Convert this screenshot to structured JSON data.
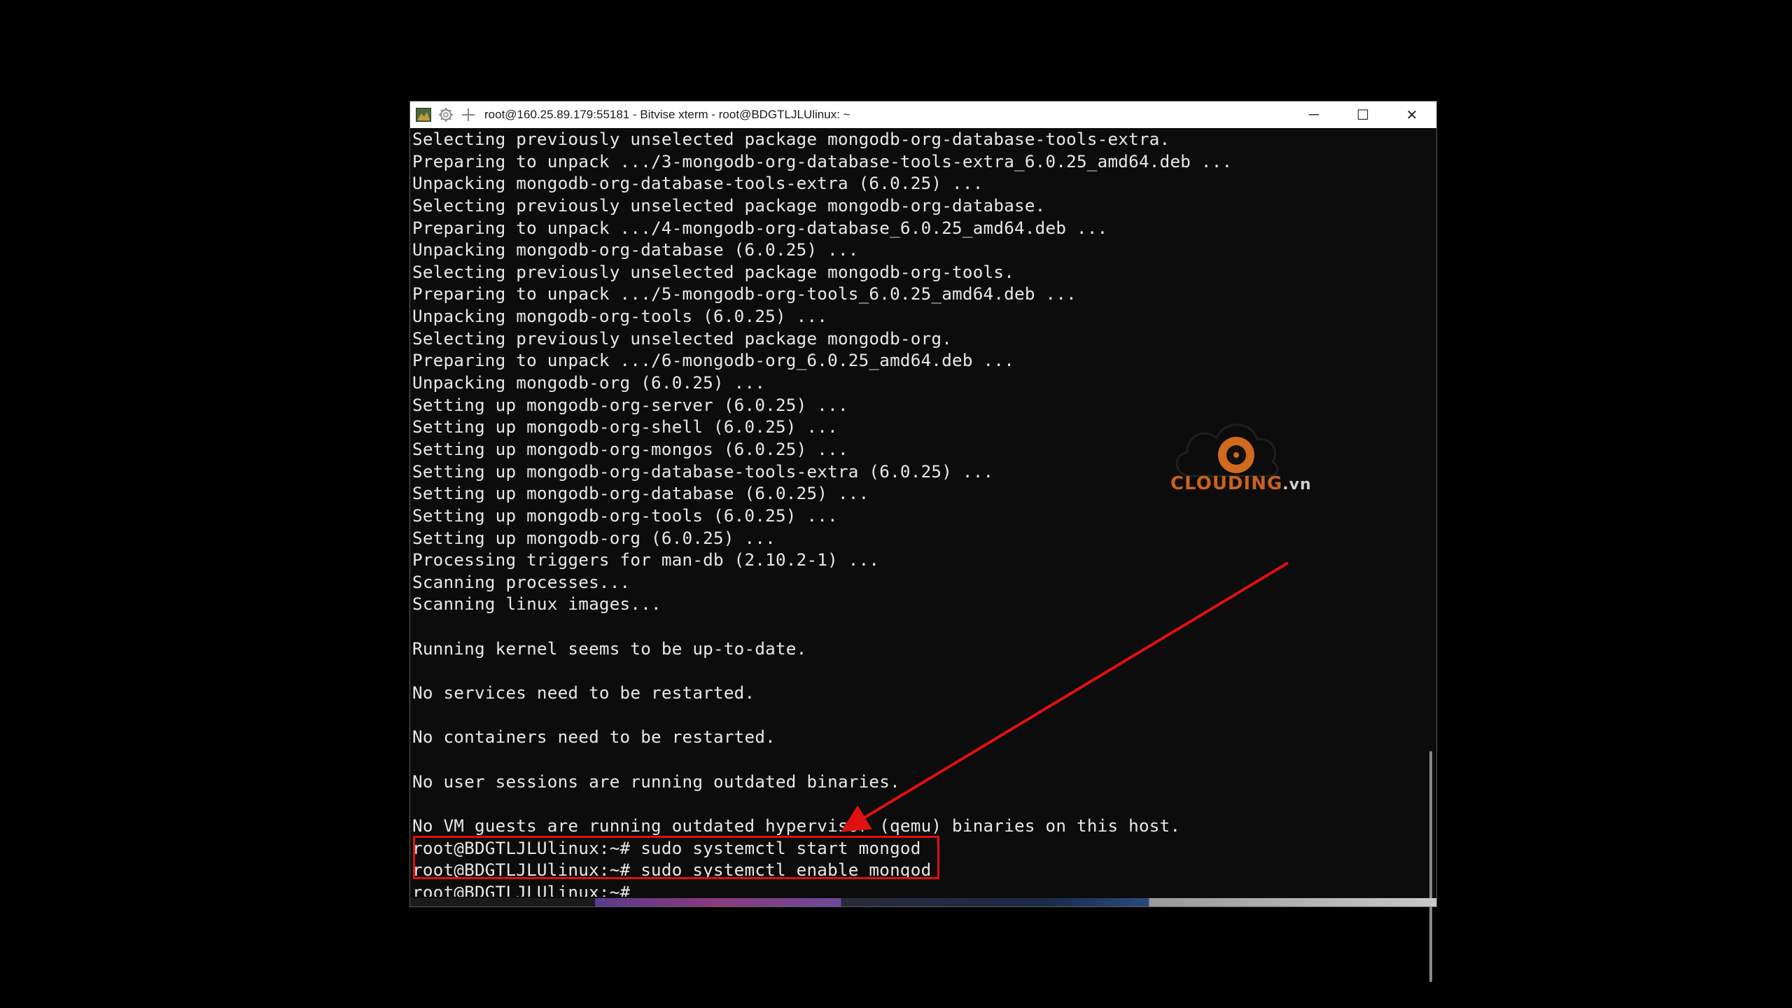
{
  "window": {
    "title": "root@160.25.89.179:55181 - Bitvise xterm - root@BDGTLJLUlinux: ~",
    "controls": {
      "minimize": "─",
      "maximize": "☐",
      "close": "✕"
    }
  },
  "terminal": {
    "lines": [
      "Selecting previously unselected package mongodb-org-database-tools-extra.",
      "Preparing to unpack .../3-mongodb-org-database-tools-extra_6.0.25_amd64.deb ...",
      "Unpacking mongodb-org-database-tools-extra (6.0.25) ...",
      "Selecting previously unselected package mongodb-org-database.",
      "Preparing to unpack .../4-mongodb-org-database_6.0.25_amd64.deb ...",
      "Unpacking mongodb-org-database (6.0.25) ...",
      "Selecting previously unselected package mongodb-org-tools.",
      "Preparing to unpack .../5-mongodb-org-tools_6.0.25_amd64.deb ...",
      "Unpacking mongodb-org-tools (6.0.25) ...",
      "Selecting previously unselected package mongodb-org.",
      "Preparing to unpack .../6-mongodb-org_6.0.25_amd64.deb ...",
      "Unpacking mongodb-org (6.0.25) ...",
      "Setting up mongodb-org-server (6.0.25) ...",
      "Setting up mongodb-org-shell (6.0.25) ...",
      "Setting up mongodb-org-mongos (6.0.25) ...",
      "Setting up mongodb-org-database-tools-extra (6.0.25) ...",
      "Setting up mongodb-org-database (6.0.25) ...",
      "Setting up mongodb-org-tools (6.0.25) ...",
      "Setting up mongodb-org (6.0.25) ...",
      "Processing triggers for man-db (2.10.2-1) ...",
      "Scanning processes...",
      "Scanning linux images...",
      "",
      "Running kernel seems to be up-to-date.",
      "",
      "No services need to be restarted.",
      "",
      "No containers need to be restarted.",
      "",
      "No user sessions are running outdated binaries.",
      "",
      "No VM guests are running outdated hypervisor (qemu) binaries on this host.",
      "root@BDGTLJLUlinux:~# sudo systemctl start mongod",
      "root@BDGTLJLUlinux:~# sudo systemctl enable mongod",
      "root@BDGTLJLUlinux:~#"
    ]
  },
  "watermark": {
    "brand": "CLOUDING",
    "tld": ".vn"
  },
  "colors": {
    "terminal_bg": "#0c0c0c",
    "terminal_fg": "#e8e8e8",
    "highlight": "#e01010",
    "brand": "#c8621e"
  }
}
